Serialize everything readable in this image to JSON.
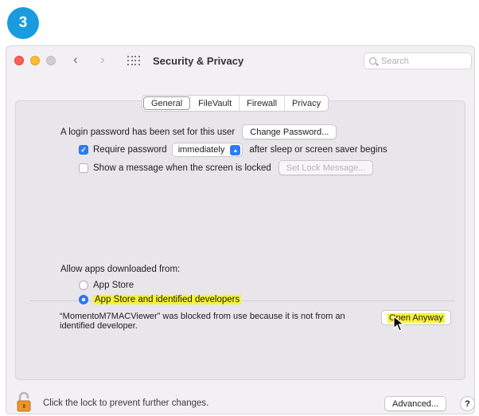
{
  "step": "3",
  "window": {
    "title": "Security & Privacy",
    "search_placeholder": "Search"
  },
  "tabs": [
    {
      "label": "General",
      "active": true
    },
    {
      "label": "FileVault",
      "active": false
    },
    {
      "label": "Firewall",
      "active": false
    },
    {
      "label": "Privacy",
      "active": false
    }
  ],
  "general": {
    "login_password_text": "A login password has been set for this user",
    "change_password_label": "Change Password...",
    "require_password_label": "Require password",
    "require_password_checked": true,
    "require_password_delay": "immediately",
    "after_sleep_text": "after sleep or screen saver begins",
    "show_message_label": "Show a message when the screen is locked",
    "show_message_checked": false,
    "set_lock_message_label": "Set Lock Message..."
  },
  "allow_apps": {
    "heading": "Allow apps downloaded from:",
    "options": [
      {
        "label": "App Store",
        "selected": false
      },
      {
        "label": "App Store and identified developers",
        "selected": true
      }
    ],
    "blocked_message": "“MomentoM7MACViewer” was blocked from use because it is not from an identified developer.",
    "open_anyway_label": "Open Anyway"
  },
  "footer": {
    "lock_text": "Click the lock to prevent further changes.",
    "advanced_label": "Advanced...",
    "help_label": "?"
  },
  "colors": {
    "accent": "#2f7cf6",
    "highlight": "#f6f23a",
    "badge": "#1a9be0"
  }
}
